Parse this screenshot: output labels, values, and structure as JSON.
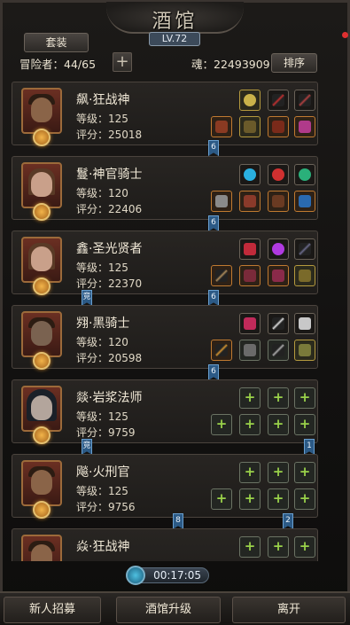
{
  "header": {
    "title": "酒馆",
    "level": "LV.72",
    "outfit_button": "套装",
    "adventurers_label": "冒险者：",
    "adventurers_count": "44/65",
    "soul_label": "魂：",
    "soul_value": "22493909",
    "sort_button": "排序"
  },
  "heroes": [
    {
      "name": "飙·狂战神",
      "level_label": "等级：",
      "level": "125",
      "score_label": "评分：",
      "score": "25018",
      "tabs": [
        "6"
      ]
    },
    {
      "name": "鬘·神官骑士",
      "level_label": "等级：",
      "level": "120",
      "score_label": "评分：",
      "score": "22406",
      "tabs": [
        "6"
      ]
    },
    {
      "name": "鑫·圣光贤者",
      "level_label": "等级：",
      "level": "125",
      "score_label": "评分：",
      "score": "22370",
      "tabs": [
        "竞",
        "6"
      ]
    },
    {
      "name": "翙·黑骑士",
      "level_label": "等级：",
      "level": "120",
      "score_label": "评分：",
      "score": "20598",
      "tabs": [
        "6"
      ]
    },
    {
      "name": "燚·岩浆法师",
      "level_label": "等级：",
      "level": "125",
      "score_label": "评分：",
      "score": "9759",
      "tabs": [
        "竞",
        "1"
      ]
    },
    {
      "name": "飚·火刑官",
      "level_label": "等级：",
      "level": "125",
      "score_label": "评分：",
      "score": "9756",
      "tabs": [
        "8",
        "2"
      ]
    },
    {
      "name": "焱·狂战神"
    }
  ],
  "timer": "00:17:05",
  "bottom": {
    "recruit": "新人招募",
    "upgrade": "酒馆升级",
    "leave": "离开"
  },
  "colors": {
    "accent_gold": "#b59a3e",
    "accent_orange": "#c07a30",
    "plus_green": "#9ad24a",
    "tab_blue": "#2c5a86"
  }
}
